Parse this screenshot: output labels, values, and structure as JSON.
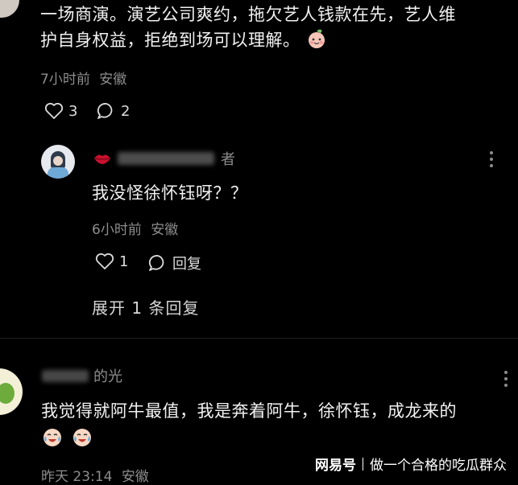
{
  "comment1": {
    "line1": "一场商演。演艺公司爽约，拖欠艺人钱款在先，艺人维",
    "line2": "护自身权益，拒绝到场可以理解。",
    "emoji": "peach-face",
    "time": "7小时前",
    "location": "安徽",
    "likes": "3",
    "replies": "2"
  },
  "reply": {
    "username_tail": "者",
    "text": "我没怪徐怀钰呀？？",
    "time": "6小时前",
    "location": "安徽",
    "likes": "1",
    "reply_label": "回复",
    "expand_label": "展开 1 条回复"
  },
  "comment2": {
    "username_tail": "的光",
    "line1": "我觉得就阿牛最值，我是奔着阿牛，徐怀钰，成龙来的",
    "emoji": "crying-laugh-face",
    "time": "昨天 23:14",
    "location": "安徽"
  },
  "watermark": {
    "brand": "网易号",
    "account": "做一个合格的吃瓜群众"
  },
  "colors": {
    "background": "#000000",
    "text": "#f2f2f2",
    "meta": "#8d8d8d"
  }
}
